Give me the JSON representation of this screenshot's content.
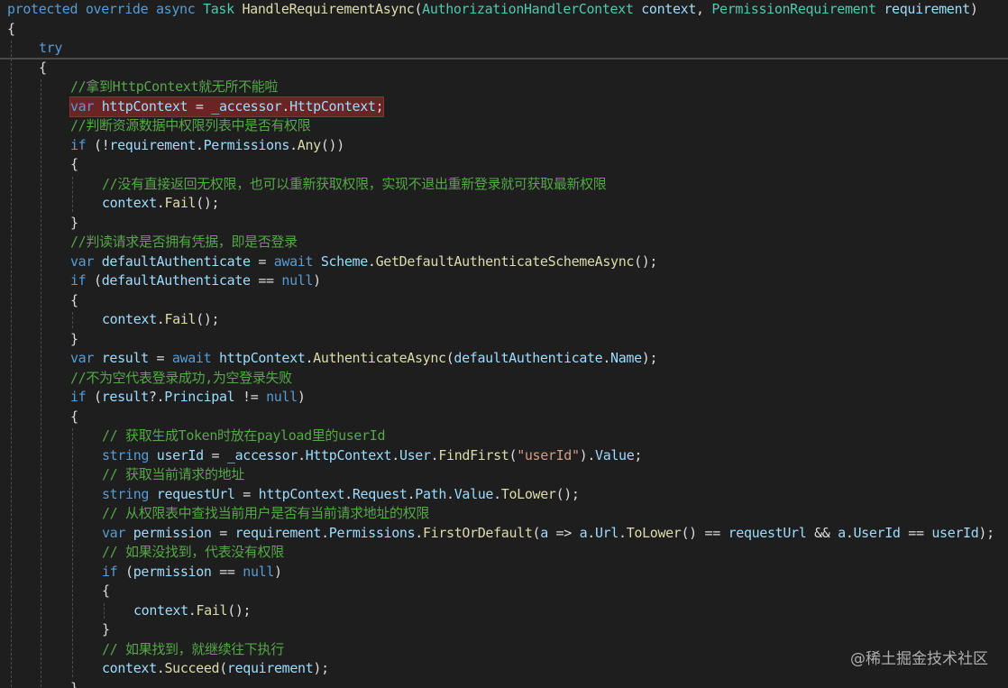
{
  "editor": {
    "lines": [
      {
        "indent": 0,
        "tokens": [
          [
            "kw",
            "protected"
          ],
          [
            "pl",
            " "
          ],
          [
            "kw",
            "override"
          ],
          [
            "pl",
            " "
          ],
          [
            "kw",
            "async"
          ],
          [
            "pl",
            " "
          ],
          [
            "ty",
            "Task"
          ],
          [
            "pl",
            " "
          ],
          [
            "me",
            "HandleRequirementAsync"
          ],
          [
            "pl",
            "("
          ],
          [
            "ty",
            "AuthorizationHandlerContext"
          ],
          [
            "pl",
            " "
          ],
          [
            "va",
            "context"
          ],
          [
            "pl",
            ", "
          ],
          [
            "ty",
            "PermissionRequirement"
          ],
          [
            "pl",
            " "
          ],
          [
            "va",
            "requirement"
          ],
          [
            "pl",
            ")"
          ]
        ]
      },
      {
        "indent": 0,
        "tokens": [
          [
            "pl",
            "{"
          ]
        ]
      },
      {
        "indent": 1,
        "tokens": [
          [
            "kw",
            "try"
          ]
        ]
      },
      {
        "indent": 1,
        "tokens": [
          [
            "pl",
            "{"
          ]
        ]
      },
      {
        "indent": 2,
        "tokens": [
          [
            "cm",
            "//拿到HttpContext就无所不能啦"
          ]
        ]
      },
      {
        "indent": 2,
        "highlight": true,
        "tokens": [
          [
            "kw",
            "var"
          ],
          [
            "pl",
            " "
          ],
          [
            "va",
            "httpContext"
          ],
          [
            "pl",
            " = "
          ],
          [
            "va",
            "_accessor"
          ],
          [
            "pl",
            "."
          ],
          [
            "va",
            "HttpContext"
          ],
          [
            "pl",
            ";"
          ]
        ]
      },
      {
        "indent": 2,
        "tokens": [
          [
            "cm",
            "//判断资源数据中权限列表中是否有权限"
          ]
        ]
      },
      {
        "indent": 2,
        "tokens": [
          [
            "kw",
            "if"
          ],
          [
            "pl",
            " (!"
          ],
          [
            "va",
            "requirement"
          ],
          [
            "pl",
            "."
          ],
          [
            "va",
            "Permissions"
          ],
          [
            "pl",
            "."
          ],
          [
            "me",
            "Any"
          ],
          [
            "pl",
            "())"
          ]
        ]
      },
      {
        "indent": 2,
        "tokens": [
          [
            "pl",
            "{"
          ]
        ]
      },
      {
        "indent": 3,
        "tokens": [
          [
            "cm",
            "//没有直接返回无权限，也可以重新获取权限，实现不退出重新登录就可获取最新权限"
          ]
        ]
      },
      {
        "indent": 3,
        "tokens": [
          [
            "va",
            "context"
          ],
          [
            "pl",
            "."
          ],
          [
            "me",
            "Fail"
          ],
          [
            "pl",
            "();"
          ]
        ]
      },
      {
        "indent": 2,
        "tokens": [
          [
            "pl",
            "}"
          ]
        ]
      },
      {
        "indent": 2,
        "tokens": [
          [
            "cm",
            "//判读请求是否拥有凭据，即是否登录"
          ]
        ]
      },
      {
        "indent": 2,
        "tokens": [
          [
            "kw",
            "var"
          ],
          [
            "pl",
            " "
          ],
          [
            "va",
            "defaultAuthenticate"
          ],
          [
            "pl",
            " = "
          ],
          [
            "kw",
            "await"
          ],
          [
            "pl",
            " "
          ],
          [
            "va",
            "Scheme"
          ],
          [
            "pl",
            "."
          ],
          [
            "me",
            "GetDefaultAuthenticateSchemeAsync"
          ],
          [
            "pl",
            "();"
          ]
        ]
      },
      {
        "indent": 2,
        "tokens": [
          [
            "kw",
            "if"
          ],
          [
            "pl",
            " ("
          ],
          [
            "va",
            "defaultAuthenticate"
          ],
          [
            "pl",
            " == "
          ],
          [
            "kw",
            "null"
          ],
          [
            "pl",
            ")"
          ]
        ]
      },
      {
        "indent": 2,
        "tokens": [
          [
            "pl",
            "{"
          ]
        ]
      },
      {
        "indent": 3,
        "tokens": [
          [
            "va",
            "context"
          ],
          [
            "pl",
            "."
          ],
          [
            "me",
            "Fail"
          ],
          [
            "pl",
            "();"
          ]
        ]
      },
      {
        "indent": 2,
        "tokens": [
          [
            "pl",
            "}"
          ]
        ]
      },
      {
        "indent": 2,
        "tokens": [
          [
            "kw",
            "var"
          ],
          [
            "pl",
            " "
          ],
          [
            "va",
            "result"
          ],
          [
            "pl",
            " = "
          ],
          [
            "kw",
            "await"
          ],
          [
            "pl",
            " "
          ],
          [
            "va",
            "httpContext"
          ],
          [
            "pl",
            "."
          ],
          [
            "me",
            "AuthenticateAsync"
          ],
          [
            "pl",
            "("
          ],
          [
            "va",
            "defaultAuthenticate"
          ],
          [
            "pl",
            "."
          ],
          [
            "va",
            "Name"
          ],
          [
            "pl",
            ");"
          ]
        ]
      },
      {
        "indent": 2,
        "tokens": [
          [
            "cm",
            "//不为空代表登录成功,为空登录失败"
          ]
        ]
      },
      {
        "indent": 2,
        "tokens": [
          [
            "kw",
            "if"
          ],
          [
            "pl",
            " ("
          ],
          [
            "va",
            "result"
          ],
          [
            "pl",
            "?."
          ],
          [
            "va",
            "Principal"
          ],
          [
            "pl",
            " != "
          ],
          [
            "kw",
            "null"
          ],
          [
            "pl",
            ")"
          ]
        ]
      },
      {
        "indent": 2,
        "tokens": [
          [
            "pl",
            "{"
          ]
        ]
      },
      {
        "indent": 3,
        "tokens": [
          [
            "cm",
            "// 获取生成Token时放在payload里的userId"
          ]
        ]
      },
      {
        "indent": 3,
        "tokens": [
          [
            "kw",
            "string"
          ],
          [
            "pl",
            " "
          ],
          [
            "va",
            "userId"
          ],
          [
            "pl",
            " = "
          ],
          [
            "va",
            "_accessor"
          ],
          [
            "pl",
            "."
          ],
          [
            "va",
            "HttpContext"
          ],
          [
            "pl",
            "."
          ],
          [
            "va",
            "User"
          ],
          [
            "pl",
            "."
          ],
          [
            "me",
            "FindFirst"
          ],
          [
            "pl",
            "("
          ],
          [
            "st",
            "\"userId\""
          ],
          [
            "pl",
            ")."
          ],
          [
            "va",
            "Value"
          ],
          [
            "pl",
            ";"
          ]
        ]
      },
      {
        "indent": 3,
        "tokens": [
          [
            "cm",
            "// 获取当前请求的地址"
          ]
        ]
      },
      {
        "indent": 3,
        "tokens": [
          [
            "kw",
            "string"
          ],
          [
            "pl",
            " "
          ],
          [
            "va",
            "requestUrl"
          ],
          [
            "pl",
            " = "
          ],
          [
            "va",
            "httpContext"
          ],
          [
            "pl",
            "."
          ],
          [
            "va",
            "Request"
          ],
          [
            "pl",
            "."
          ],
          [
            "va",
            "Path"
          ],
          [
            "pl",
            "."
          ],
          [
            "va",
            "Value"
          ],
          [
            "pl",
            "."
          ],
          [
            "me",
            "ToLower"
          ],
          [
            "pl",
            "();"
          ]
        ]
      },
      {
        "indent": 3,
        "tokens": [
          [
            "cm",
            "// 从权限表中查找当前用户是否有当前请求地址的权限"
          ]
        ]
      },
      {
        "indent": 3,
        "tokens": [
          [
            "kw",
            "var"
          ],
          [
            "pl",
            " "
          ],
          [
            "va",
            "permission"
          ],
          [
            "pl",
            " = "
          ],
          [
            "va",
            "requirement"
          ],
          [
            "pl",
            "."
          ],
          [
            "va",
            "Permissions"
          ],
          [
            "pl",
            "."
          ],
          [
            "me",
            "FirstOrDefault"
          ],
          [
            "pl",
            "("
          ],
          [
            "va",
            "a"
          ],
          [
            "pl",
            " => "
          ],
          [
            "va",
            "a"
          ],
          [
            "pl",
            "."
          ],
          [
            "va",
            "Url"
          ],
          [
            "pl",
            "."
          ],
          [
            "me",
            "ToLower"
          ],
          [
            "pl",
            "() == "
          ],
          [
            "va",
            "requestUrl"
          ],
          [
            "pl",
            " && "
          ],
          [
            "va",
            "a"
          ],
          [
            "pl",
            "."
          ],
          [
            "va",
            "UserId"
          ],
          [
            "pl",
            " == "
          ],
          [
            "va",
            "userId"
          ],
          [
            "pl",
            ");"
          ]
        ]
      },
      {
        "indent": 3,
        "tokens": [
          [
            "cm",
            "// 如果没找到，代表没有权限"
          ]
        ]
      },
      {
        "indent": 3,
        "tokens": [
          [
            "kw",
            "if"
          ],
          [
            "pl",
            " ("
          ],
          [
            "va",
            "permission"
          ],
          [
            "pl",
            " == "
          ],
          [
            "kw",
            "null"
          ],
          [
            "pl",
            ")"
          ]
        ]
      },
      {
        "indent": 3,
        "tokens": [
          [
            "pl",
            "{"
          ]
        ]
      },
      {
        "indent": 4,
        "tokens": [
          [
            "va",
            "context"
          ],
          [
            "pl",
            "."
          ],
          [
            "me",
            "Fail"
          ],
          [
            "pl",
            "();"
          ]
        ]
      },
      {
        "indent": 3,
        "tokens": [
          [
            "pl",
            "}"
          ]
        ]
      },
      {
        "indent": 3,
        "tokens": [
          [
            "cm",
            "// 如果找到，就继续往下执行"
          ]
        ]
      },
      {
        "indent": 3,
        "tokens": [
          [
            "va",
            "context"
          ],
          [
            "pl",
            "."
          ],
          [
            "me",
            "Succeed"
          ],
          [
            "pl",
            "("
          ],
          [
            "va",
            "requirement"
          ],
          [
            "pl",
            ");"
          ]
        ]
      },
      {
        "indent": 2,
        "tokens": [
          [
            "pl",
            "}"
          ]
        ]
      }
    ]
  },
  "watermark": "@稀土掘金技术社区"
}
